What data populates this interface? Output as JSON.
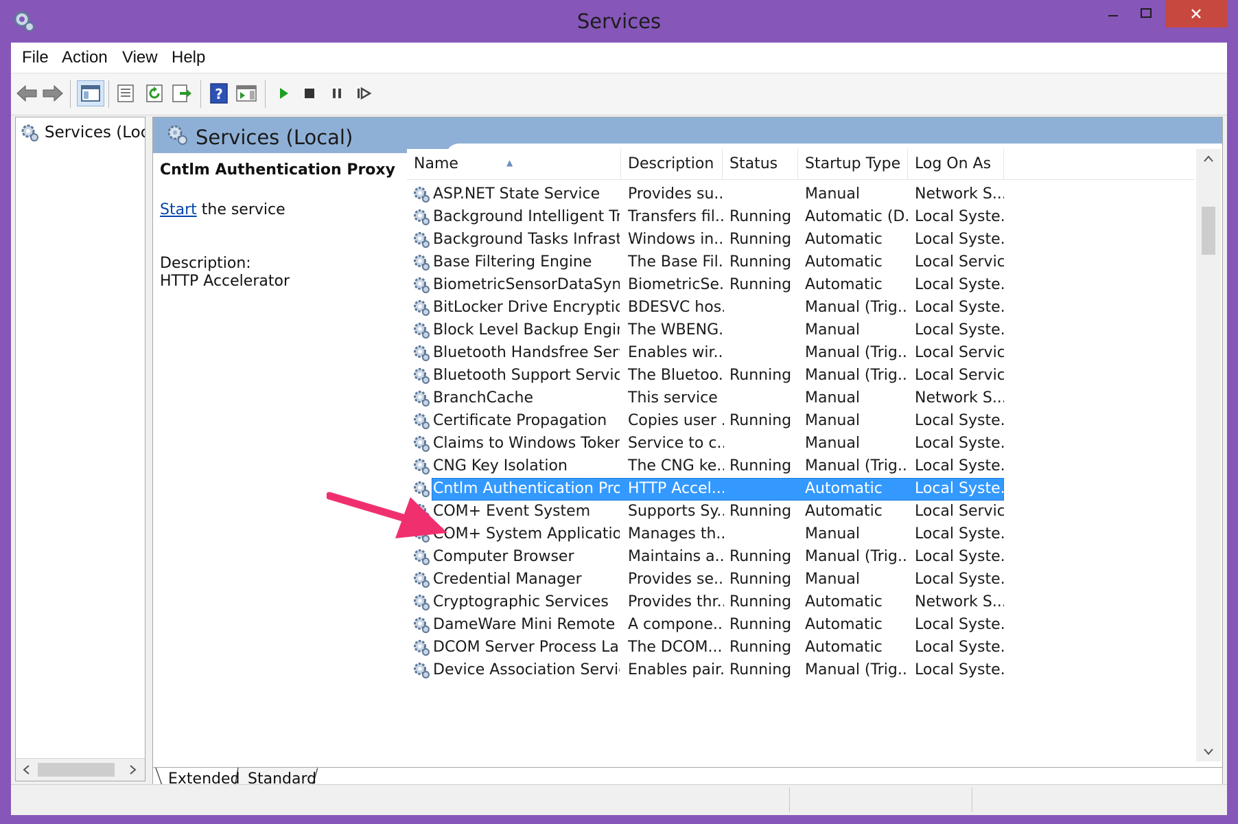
{
  "window": {
    "title": "Services",
    "app_icon": "services-gear-icon",
    "controls": {
      "minimize": "minimize-icon",
      "maximize": "maximize-icon",
      "close": "close-icon"
    }
  },
  "menu": [
    "File",
    "Action",
    "View",
    "Help"
  ],
  "toolbar": {
    "icons": [
      "back-arrow-icon",
      "forward-arrow-icon",
      "show-hide-console-tree-icon",
      "properties-icon",
      "refresh-icon",
      "export-list-icon",
      "help-icon",
      "show-hide-action-pane-icon",
      "start-service-icon",
      "stop-service-icon",
      "pause-service-icon",
      "resume-service-icon"
    ]
  },
  "tree": {
    "item": "Services (Local)"
  },
  "pane": {
    "title": "Services (Local)"
  },
  "details": {
    "name": "Cntlm Authentication Proxy",
    "start_link": "Start",
    "start_suffix": " the service",
    "description_label": "Description:",
    "description": "HTTP Accelerator"
  },
  "table": {
    "columns": [
      "Name",
      "Description",
      "Status",
      "Startup Type",
      "Log On As"
    ],
    "rows": [
      [
        "ASP.NET State Service",
        "Provides su...",
        "",
        "Manual",
        "Network S..."
      ],
      [
        "Background Intelligent Tran...",
        "Transfers fil...",
        "Running",
        "Automatic (D...",
        "Local Syste..."
      ],
      [
        "Background Tasks Infrastru...",
        "Windows in...",
        "Running",
        "Automatic",
        "Local Syste..."
      ],
      [
        "Base Filtering Engine",
        "The Base Fil...",
        "Running",
        "Automatic",
        "Local Service"
      ],
      [
        "BiometricSensorDataSynchr...",
        "BiometricSe...",
        "Running",
        "Automatic",
        "Local Syste..."
      ],
      [
        "BitLocker Drive Encryption ...",
        "BDESVC hos...",
        "",
        "Manual (Trig...",
        "Local Syste..."
      ],
      [
        "Block Level Backup Engine ...",
        "The WBENG...",
        "",
        "Manual",
        "Local Syste..."
      ],
      [
        "Bluetooth Handsfree Service",
        "Enables wir...",
        "",
        "Manual (Trig...",
        "Local Service"
      ],
      [
        "Bluetooth Support Service",
        "The Bluetoo...",
        "Running",
        "Manual (Trig...",
        "Local Service"
      ],
      [
        "BranchCache",
        "This service ...",
        "",
        "Manual",
        "Network S..."
      ],
      [
        "Certificate Propagation",
        "Copies user ...",
        "Running",
        "Manual",
        "Local Syste..."
      ],
      [
        "Claims to Windows Token S...",
        "Service to c...",
        "",
        "Manual",
        "Local Syste..."
      ],
      [
        "CNG Key Isolation",
        "The CNG ke...",
        "Running",
        "Manual (Trig...",
        "Local Syste..."
      ],
      [
        "Cntlm Authentication Proxy",
        "HTTP Accel...",
        "",
        "Automatic",
        "Local Syste..."
      ],
      [
        "COM+ Event System",
        "Supports Sy...",
        "Running",
        "Automatic",
        "Local Service"
      ],
      [
        "COM+ System Application",
        "Manages th...",
        "",
        "Manual",
        "Local Syste..."
      ],
      [
        "Computer Browser",
        "Maintains a...",
        "Running",
        "Manual (Trig...",
        "Local Syste..."
      ],
      [
        "Credential Manager",
        "Provides se...",
        "Running",
        "Manual",
        "Local Syste..."
      ],
      [
        "Cryptographic Services",
        "Provides thr...",
        "Running",
        "Automatic",
        "Network S..."
      ],
      [
        "DameWare Mini Remote Co...",
        "A compone...",
        "Running",
        "Automatic",
        "Local Syste..."
      ],
      [
        "DCOM Server Process Laun...",
        "The DCOM...",
        "Running",
        "Automatic",
        "Local Syste..."
      ],
      [
        "Device Association Service",
        "Enables pair...",
        "Running",
        "Manual (Trig...",
        "Local Syste..."
      ]
    ],
    "selected_row": 13
  },
  "tabs": [
    "Extended",
    "Standard"
  ],
  "annotation": {
    "icon": "pink-arrow-icon",
    "color": "#f0306e"
  },
  "colors": {
    "window_frame": "#8656b9",
    "header_band": "#8fb0d6",
    "selection": "#3399ff",
    "close_button": "#c7483f"
  }
}
